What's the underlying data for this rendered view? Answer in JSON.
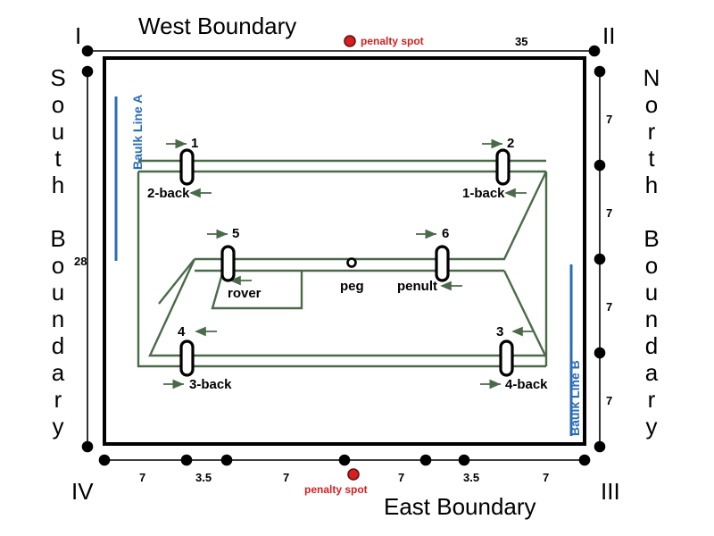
{
  "diagram": {
    "kind": "croquet-court-layout",
    "colors": {
      "boundary": "#000000",
      "court_path": "#4a6a4a",
      "baulk_line": "#2b6cb8",
      "penalty_spot": "#d62020",
      "dimension": "#000000"
    }
  },
  "boundaries": {
    "west": "West Boundary",
    "south": "South Boundary",
    "north": "North Boundary",
    "east": "East Boundary"
  },
  "corners": {
    "i": "I",
    "ii": "II",
    "iii": "III",
    "iv": "IV"
  },
  "dimensions": {
    "top_total": "35",
    "left_total": "28",
    "right_segments": [
      "7",
      "7",
      "7",
      "7"
    ],
    "bottom_segments": [
      "7",
      "3.5",
      "7",
      "7",
      "3.5",
      "7"
    ]
  },
  "penalty_spots": {
    "top_label": "penalty spot",
    "bottom_label": "penalty spot"
  },
  "baulk_lines": {
    "a": "Baulk Line A",
    "b": "Baulk Line B"
  },
  "hoops": [
    {
      "number": "1",
      "back_label": "2-back",
      "num_arrow": "right",
      "back_arrow": "left"
    },
    {
      "number": "2",
      "back_label": "1-back",
      "num_arrow": "right",
      "back_arrow": "left"
    },
    {
      "number": "5",
      "back_label": "rover",
      "num_arrow": "right",
      "back_arrow": "left"
    },
    {
      "number": "6",
      "back_label": "penult",
      "num_arrow": "right",
      "back_arrow": "left"
    },
    {
      "number": "4",
      "back_label": "3-back",
      "num_arrow": "left",
      "back_arrow": "right"
    },
    {
      "number": "3",
      "back_label": "4-back",
      "num_arrow": "left",
      "back_arrow": "right"
    }
  ],
  "peg": {
    "label": "peg"
  }
}
